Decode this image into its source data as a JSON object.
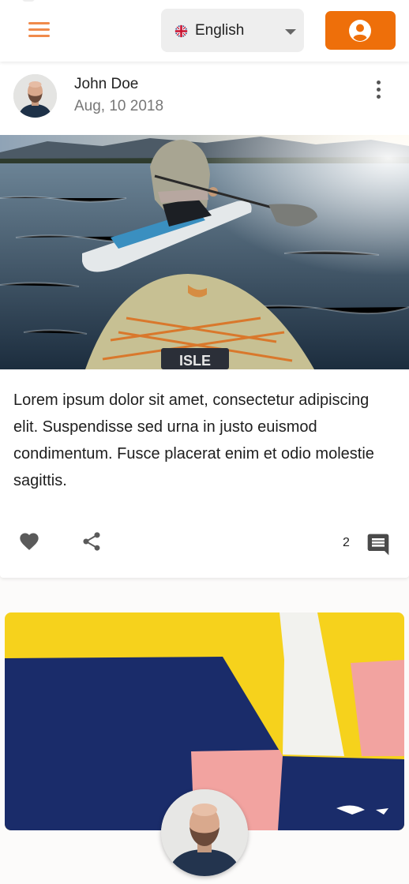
{
  "header": {
    "language": {
      "selected": "English",
      "flag_icon": "uk-flag-icon"
    },
    "menu_icon": "hamburger-menu-icon",
    "account_icon": "account-circle-icon",
    "accent_color": "#ee6f0a"
  },
  "post": {
    "author": "John Doe",
    "date": "Aug, 10 2018",
    "text": "Lorem ipsum dolor sit amet, consectetur adipiscing elit. Suspendisse sed urna in justo euismod condimentum. Fusce placerat enim et odio molestie sagittis.",
    "comment_count": "2",
    "icons": [
      "heart-icon",
      "share-icon",
      "comment-icon",
      "more-vert-icon"
    ]
  }
}
